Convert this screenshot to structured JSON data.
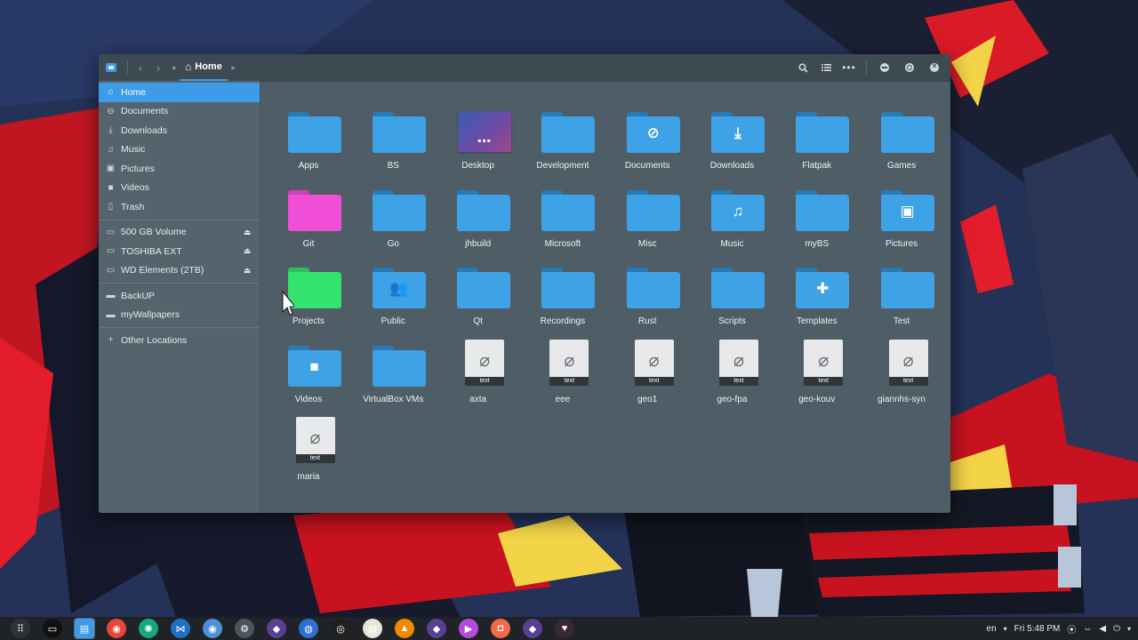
{
  "window": {
    "breadcrumb": "Home"
  },
  "sidebar": {
    "places": [
      {
        "label": "Home",
        "icon": "home-icon",
        "active": true
      },
      {
        "label": "Documents",
        "icon": "documents-icon"
      },
      {
        "label": "Downloads",
        "icon": "downloads-icon"
      },
      {
        "label": "Music",
        "icon": "music-icon"
      },
      {
        "label": "Pictures",
        "icon": "pictures-icon"
      },
      {
        "label": "Videos",
        "icon": "videos-icon"
      },
      {
        "label": "Trash",
        "icon": "trash-icon"
      }
    ],
    "devices": [
      {
        "label": "500 GB Volume",
        "icon": "drive-icon"
      },
      {
        "label": "TOSHIBA EXT",
        "icon": "drive-icon"
      },
      {
        "label": "WD Elements (2TB)",
        "icon": "drive-icon"
      }
    ],
    "bookmarks": [
      {
        "label": "BackUP",
        "icon": "folder-icon"
      },
      {
        "label": "myWallpapers",
        "icon": "folder-icon"
      }
    ],
    "other": {
      "label": "Other Locations",
      "icon": "plus-icon"
    }
  },
  "files": [
    {
      "name": "Apps",
      "kind": "folder"
    },
    {
      "name": "BS",
      "kind": "folder"
    },
    {
      "name": "Desktop",
      "kind": "desktop"
    },
    {
      "name": "Development",
      "kind": "folder"
    },
    {
      "name": "Documents",
      "kind": "folder",
      "emblem": "paperclip-icon"
    },
    {
      "name": "Downloads",
      "kind": "folder",
      "emblem": "download-icon"
    },
    {
      "name": "Flatpak",
      "kind": "folder"
    },
    {
      "name": "Games",
      "kind": "folder"
    },
    {
      "name": "Git",
      "kind": "folder",
      "color": "#f04ed6"
    },
    {
      "name": "Go",
      "kind": "folder"
    },
    {
      "name": "jhbuild",
      "kind": "folder"
    },
    {
      "name": "Microsoft",
      "kind": "folder"
    },
    {
      "name": "Misc",
      "kind": "folder"
    },
    {
      "name": "Music",
      "kind": "folder",
      "emblem": "music-note-icon"
    },
    {
      "name": "myBS",
      "kind": "folder"
    },
    {
      "name": "Pictures",
      "kind": "folder",
      "emblem": "image-icon"
    },
    {
      "name": "Projects",
      "kind": "folder",
      "color": "#34e26f"
    },
    {
      "name": "Public",
      "kind": "folder",
      "emblem": "people-icon"
    },
    {
      "name": "Qt",
      "kind": "folder"
    },
    {
      "name": "Recordings",
      "kind": "folder"
    },
    {
      "name": "Rust",
      "kind": "folder"
    },
    {
      "name": "Scripts",
      "kind": "folder"
    },
    {
      "name": "Templates",
      "kind": "folder",
      "emblem": "puzzle-icon"
    },
    {
      "name": "Test",
      "kind": "folder"
    },
    {
      "name": "Videos",
      "kind": "folder",
      "emblem": "video-camera-icon"
    },
    {
      "name": "VirtualBox VMs",
      "kind": "folder"
    },
    {
      "name": "axta",
      "kind": "text",
      "tag": "text"
    },
    {
      "name": "eee",
      "kind": "text",
      "tag": "text"
    },
    {
      "name": "geo1",
      "kind": "text",
      "tag": "text"
    },
    {
      "name": "geo-fpa",
      "kind": "text",
      "tag": "text"
    },
    {
      "name": "geo-kouv",
      "kind": "text",
      "tag": "text"
    },
    {
      "name": "giannhs-syn",
      "kind": "text",
      "tag": "text"
    },
    {
      "name": "maria",
      "kind": "text",
      "tag": "text"
    }
  ],
  "colors": {
    "folder": "#3ea2e6",
    "folder_tab": "#2f8fd4",
    "accent": "#3d9be8"
  },
  "taskbar": {
    "apps": [
      "apps-grid-icon",
      "terminal-icon",
      "files-icon",
      "chrome-icon",
      "gitkraken-icon",
      "vscode-icon",
      "chromium-icon",
      "steam-icon",
      "app-icon",
      "browser-icon",
      "obs-icon",
      "notes-icon",
      "vlc-icon",
      "app-icon",
      "media-player-icon",
      "screenshot-icon",
      "app-icon",
      "heart-icon"
    ],
    "tray": {
      "lang": "en",
      "clock": "Fri  5:48 PM"
    }
  }
}
